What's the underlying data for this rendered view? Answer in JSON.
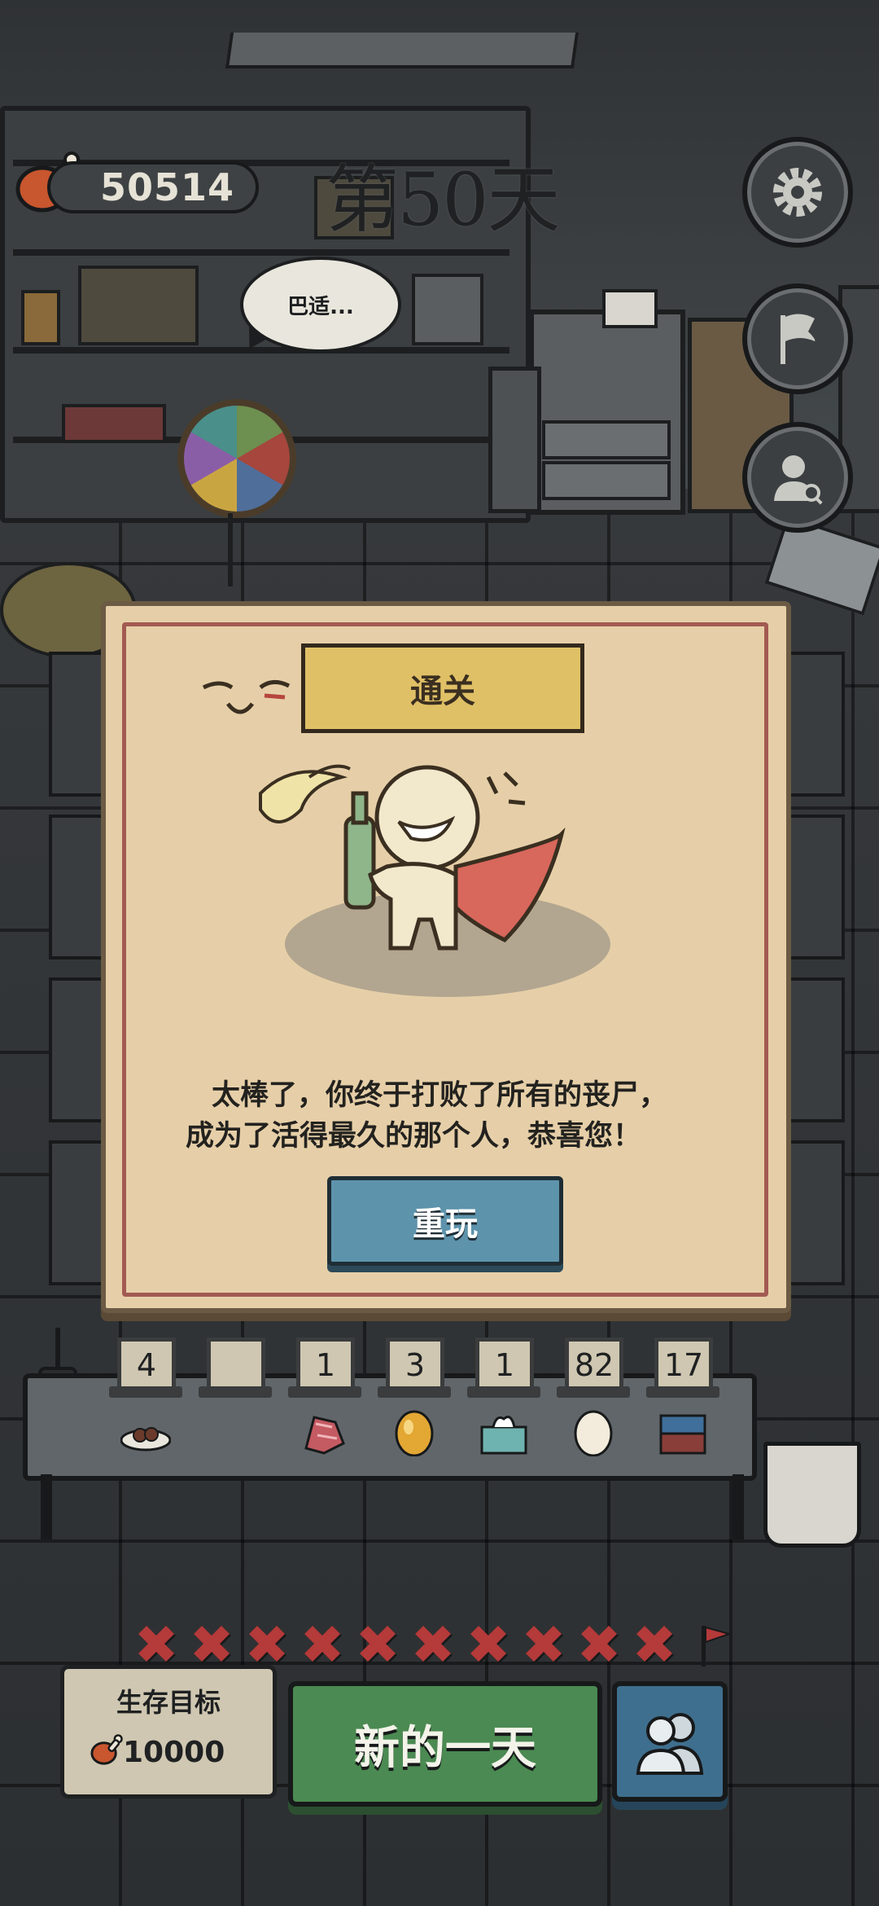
{
  "hud": {
    "meat_count": "50514",
    "day_label": "第50天",
    "npc_speech": "巴适..."
  },
  "icons": {
    "settings": "gear-icon",
    "flag": "flag-icon",
    "profile": "person-search-icon",
    "meat": "meat-drumstick-icon",
    "people": "people-icon"
  },
  "popup": {
    "title": "通关",
    "message_line1": "太棒了，你终于打败了所有的丧尸，",
    "message_line2": "成为了活得最久的那个人，恭喜您！",
    "replay_label": "重玩"
  },
  "inventory": [
    {
      "count": "4",
      "item": "snack-plate"
    },
    {
      "count": "",
      "item": "empty"
    },
    {
      "count": "1",
      "item": "raw-meat"
    },
    {
      "count": "3",
      "item": "golden-egg"
    },
    {
      "count": "1",
      "item": "tissue-box"
    },
    {
      "count": "82",
      "item": "egg"
    },
    {
      "count": "17",
      "item": "clothes-stack"
    }
  ],
  "progress": {
    "failed_days_marked": 10,
    "mark": "✖"
  },
  "goal": {
    "label": "生存目标",
    "value": "10000"
  },
  "actions": {
    "new_day_label": "新的一天"
  },
  "colors": {
    "accent_red": "#b53a3a",
    "new_day_green": "#4b8a52",
    "replay_blue": "#5d93ab",
    "paper": "#e6cfa8"
  }
}
